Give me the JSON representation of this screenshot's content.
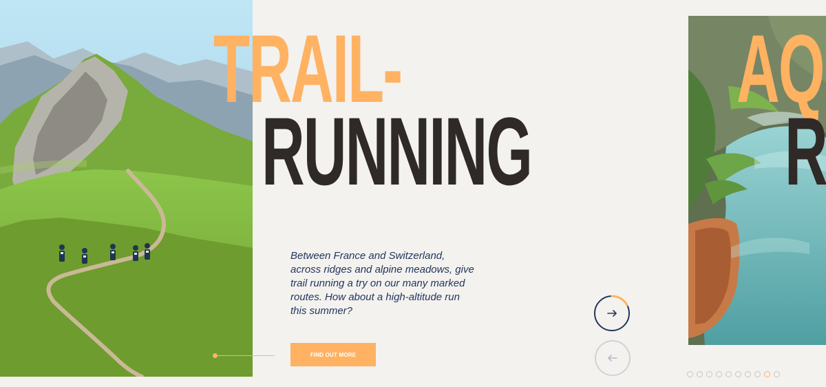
{
  "slide": {
    "title_line_1": "TRAIL-",
    "title_line_2": "RUNNING",
    "description": "Between France and Switzerland, across ridges and alpine meadows, give trail running a try on our many marked routes. How about a high-altitude run this summer?",
    "cta_label": "FIND OUT MORE"
  },
  "next_slide": {
    "title_line_1": "AQ",
    "title_line_2": "R"
  },
  "navigation": {
    "next_icon": "arrow-right-icon",
    "prev_icon": "arrow-left-icon",
    "dots_count": 10,
    "active_dot": 9
  },
  "colors": {
    "accent": "#ffb262",
    "dark_title": "#2f2a27",
    "navy": "#22365c",
    "background": "#f3f2ef"
  }
}
